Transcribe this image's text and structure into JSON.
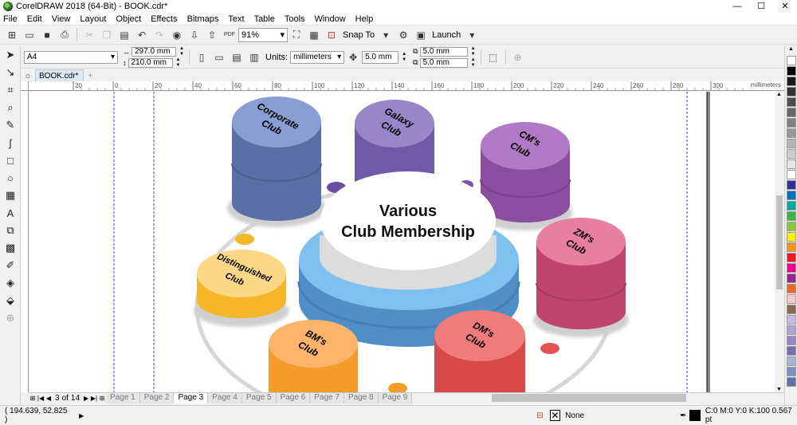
{
  "window": {
    "title": "CorelDRAW 2018 (64-Bit) - BOOK.cdr*",
    "minimize": "—",
    "maximize": "☐",
    "close": "✕"
  },
  "menu": [
    "File",
    "Edit",
    "View",
    "Layout",
    "Object",
    "Effects",
    "Bitmaps",
    "Text",
    "Table",
    "Tools",
    "Window",
    "Help"
  ],
  "toolbar": {
    "zoom_value": "91%",
    "snap_to_label": "Snap To",
    "launch_label": "Launch",
    "pdf_label": "PDF"
  },
  "properties": {
    "page_size": "A4",
    "width": "297.0 mm",
    "height": "210.0 mm",
    "units_label": "Units:",
    "units_value": "millimeters",
    "nudge": "5.0 mm",
    "dup_x": "5.0 mm",
    "dup_y": "5.0 mm"
  },
  "document_tab": "BOOK.cdr*",
  "ruler": {
    "ticks": [
      "20",
      "0",
      "20",
      "40",
      "60",
      "80",
      "100",
      "120",
      "140",
      "160",
      "180",
      "200",
      "220",
      "240",
      "260",
      "280",
      "300"
    ],
    "unit": "millimeters"
  },
  "diagram": {
    "center_title_line1": "Various",
    "center_title_line2": "Club Membership",
    "clubs": [
      {
        "line1": "Corporate",
        "line2": "Club"
      },
      {
        "line1": "Galaxy",
        "line2": "Club"
      },
      {
        "line1": "CM's",
        "line2": "Club"
      },
      {
        "line1": "ZM's",
        "line2": "Club"
      },
      {
        "line1": "DM's",
        "line2": "Club"
      },
      {
        "line1": "BM's",
        "line2": "Club"
      },
      {
        "line1": "Distinguished",
        "line2": "Club"
      }
    ]
  },
  "pagebar": {
    "current": "3",
    "of_label": "of",
    "total": "14",
    "tabs": [
      "Page 1",
      "Page 2",
      "Page 3",
      "Page 4",
      "Page 5",
      "Page 6",
      "Page 7",
      "Page 8",
      "Page 9"
    ],
    "active_index": 2
  },
  "status": {
    "coordinates": "( 194.639, 52.825 )",
    "fill_label": "None",
    "outline_info": "C:0 M:0 Y:0 K:100  0.567 pt"
  },
  "palette": [
    "#ffffff",
    "#000000",
    "#1a1a1a",
    "#333333",
    "#4d4d4d",
    "#666666",
    "#808080",
    "#999999",
    "#b3b3b3",
    "#cccccc",
    "#e6e6e6",
    "#ffffff",
    "#2e3192",
    "#0071bc",
    "#00a99d",
    "#39b54a",
    "#8cc63f",
    "#fff200",
    "#f7941d",
    "#ed1c24",
    "#ec008c",
    "#92278f",
    "#f26522",
    "#f9c6c9",
    "#8b6b4a",
    "#c8b8e8",
    "#b0a0d8",
    "#9a86cc",
    "#7d6bb8",
    "#a4b4d8",
    "#8090c0",
    "#6070a8"
  ]
}
